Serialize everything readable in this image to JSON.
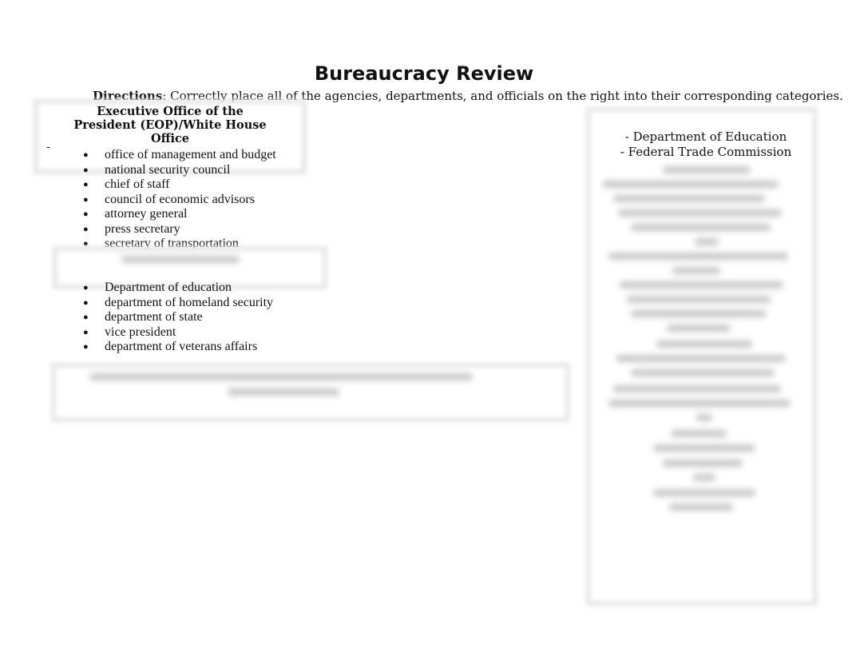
{
  "document": {
    "title": "Bureaucracy Review",
    "directions_label": "Directions",
    "directions_text": ": Correctly place all of the agencies, departments, and officials on the right into their corresponding categories."
  },
  "eop_section": {
    "heading": "Executive Office of the President (EOP)/White House Office",
    "dash": "-",
    "items": [
      "office of management and budget",
      "national security council",
      "chief of staff",
      "council of economic advisors",
      "attorney general",
      "press secretary",
      "secretary of transportation"
    ]
  },
  "cabinet_section": {
    "items": [
      "Department of education",
      "department of homeland security",
      "department of state",
      "vice president",
      "department of veterans affairs"
    ]
  },
  "word_bank": {
    "items": [
      "- Department of Education",
      "- Federal Trade Commission"
    ]
  }
}
